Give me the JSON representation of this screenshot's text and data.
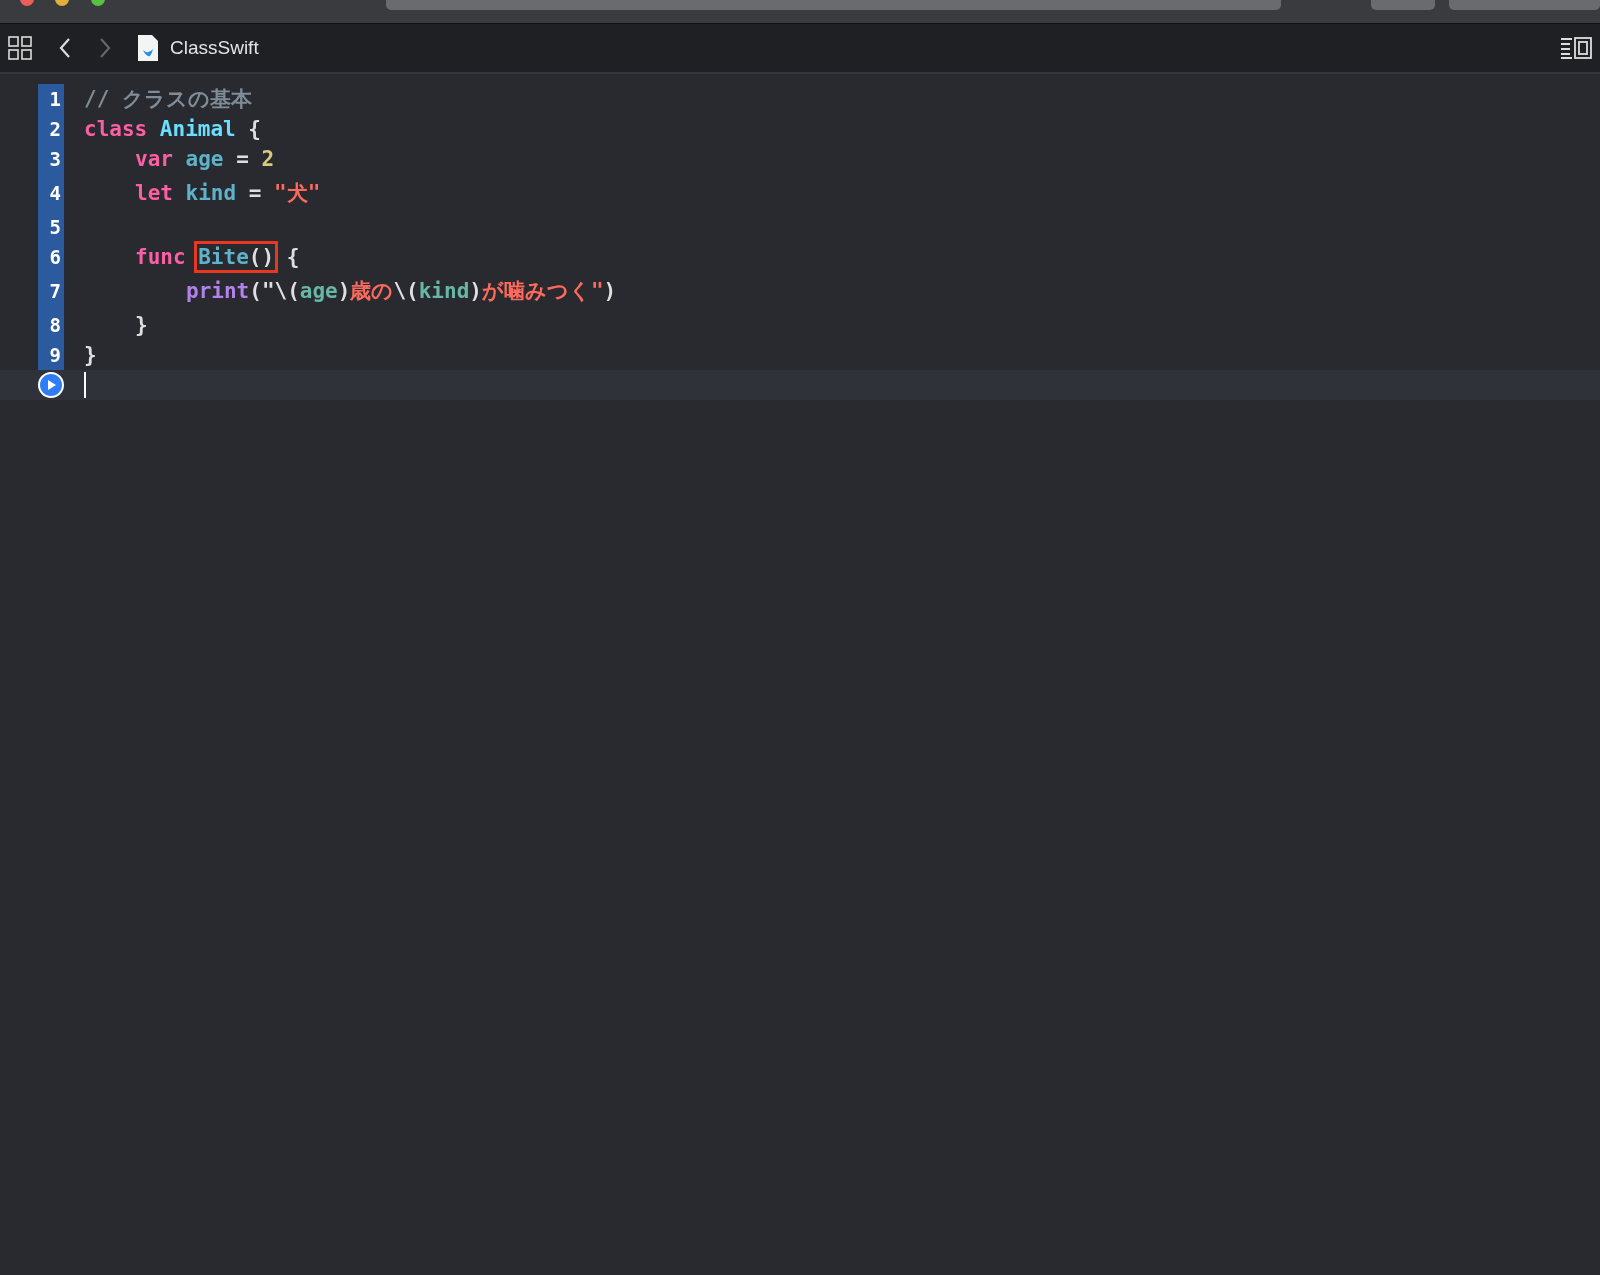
{
  "breadcrumb": {
    "file": "ClassSwift"
  },
  "lines": [
    {
      "kind": "code",
      "number": "1",
      "tokens": [
        {
          "text": "// クラスの基本",
          "kind": "comment"
        }
      ]
    },
    {
      "kind": "code",
      "number": "2",
      "tokens": [
        {
          "text": "class ",
          "kind": "keyword"
        },
        {
          "text": "Animal",
          "kind": "type"
        },
        {
          "text": " {",
          "kind": "plain"
        }
      ],
      "children": [
        {
          "kind": "code",
          "number": "3",
          "tokens": [
            {
              "text": "var ",
              "kind": "keyword"
            },
            {
              "text": "age",
              "kind": "property"
            },
            {
              "text": " = ",
              "kind": "plain"
            },
            {
              "text": "2",
              "kind": "number"
            }
          ]
        },
        {
          "kind": "code",
          "number": "4",
          "tokens": [
            {
              "text": "let ",
              "kind": "keyword"
            },
            {
              "text": "kind",
              "kind": "property"
            },
            {
              "text": " = ",
              "kind": "plain"
            },
            {
              "text": "\"犬\"",
              "kind": "string"
            }
          ]
        },
        {
          "kind": "code",
          "number": "5"
        },
        {
          "kind": "code",
          "number": "6",
          "tokens": [
            {
              "text": "func ",
              "kind": "keyword"
            },
            {
              "text": "Bite",
              "kind": "property",
              "boxed": true
            },
            {
              "text": "()",
              "kind": "plain",
              "boxed": true
            },
            {
              "text": " {",
              "kind": "plain"
            }
          ],
          "children": [
            {
              "kind": "code",
              "number": "7",
              "tokens": [
                {
                  "text": "print",
                  "kind": "function"
                },
                {
                  "text": "(",
                  "kind": "plain"
                },
                {
                  "text": "\"\\(",
                  "kind": "plain"
                },
                {
                  "text": "age",
                  "kind": "variable"
                },
                {
                  "text": ")",
                  "kind": "plain"
                },
                {
                  "text": "歳の",
                  "kind": "string"
                },
                {
                  "text": "\\(",
                  "kind": "plain"
                },
                {
                  "text": "kind",
                  "kind": "variable"
                },
                {
                  "text": ")",
                  "kind": "plain"
                },
                {
                  "text": "が噛みつく\"",
                  "kind": "string"
                },
                {
                  "text": ")",
                  "kind": "plain"
                }
              ]
            }
          ]
        },
        {
          "kind": "code",
          "number": "8",
          "tokens": [
            {
              "text": "}",
              "kind": "plain"
            }
          ]
        }
      ]
    },
    {
      "kind": "code",
      "number": "9",
      "tokens": [
        {
          "text": "}",
          "kind": "plain"
        }
      ]
    },
    {
      "kind": "current"
    }
  ]
}
